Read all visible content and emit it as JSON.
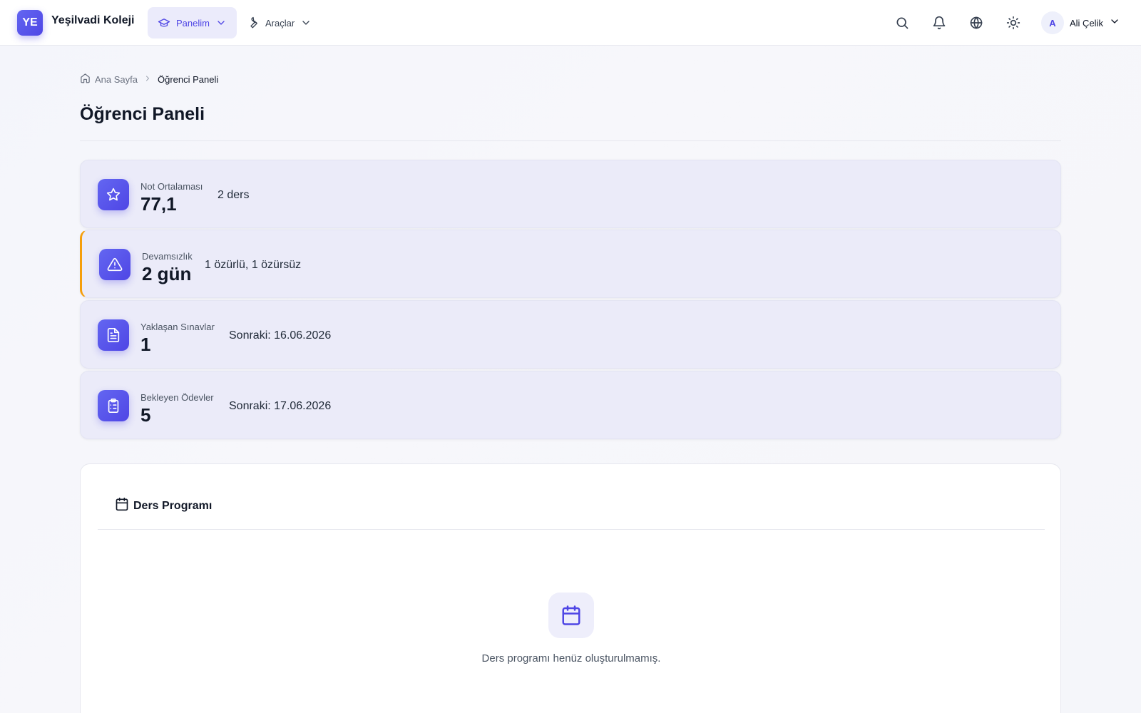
{
  "header": {
    "logo_initials": "YE",
    "brand": "Yeşilvadi Koleji",
    "menus": [
      {
        "label": "Panelim",
        "active": true
      },
      {
        "label": "Araçlar",
        "active": false
      }
    ],
    "icons": [
      "search-icon",
      "bell-icon",
      "globe-icon",
      "sun-icon"
    ],
    "user": {
      "initial": "A",
      "name": "Ali Çelik"
    }
  },
  "breadcrumb": {
    "home": "Ana Sayfa",
    "current": "Öğrenci Paneli"
  },
  "page_title": "Öğrenci Paneli",
  "stats": [
    {
      "label": "Not Ortalaması",
      "value": "77,1",
      "sub": "2 ders",
      "icon": "star-icon",
      "warning": false
    },
    {
      "label": "Devamsızlık",
      "value": "2 gün",
      "sub": "1 özürlü, 1 özürsüz",
      "icon": "alert-triangle-icon",
      "warning": true
    },
    {
      "label": "Yaklaşan Sınavlar",
      "value": "1",
      "sub": "Sonraki: 16.06.2026",
      "icon": "document-icon",
      "warning": false
    },
    {
      "label": "Bekleyen Ödevler",
      "value": "5",
      "sub": "Sonraki: 17.06.2026",
      "icon": "clipboard-list-icon",
      "warning": false
    }
  ],
  "schedule": {
    "title": "Ders Programı",
    "empty_message": "Ders programı henüz oluşturulmamış."
  },
  "colors": {
    "accent": "#4f46e5",
    "warning": "#f59e0b",
    "card_bg": "#ebebf9"
  }
}
